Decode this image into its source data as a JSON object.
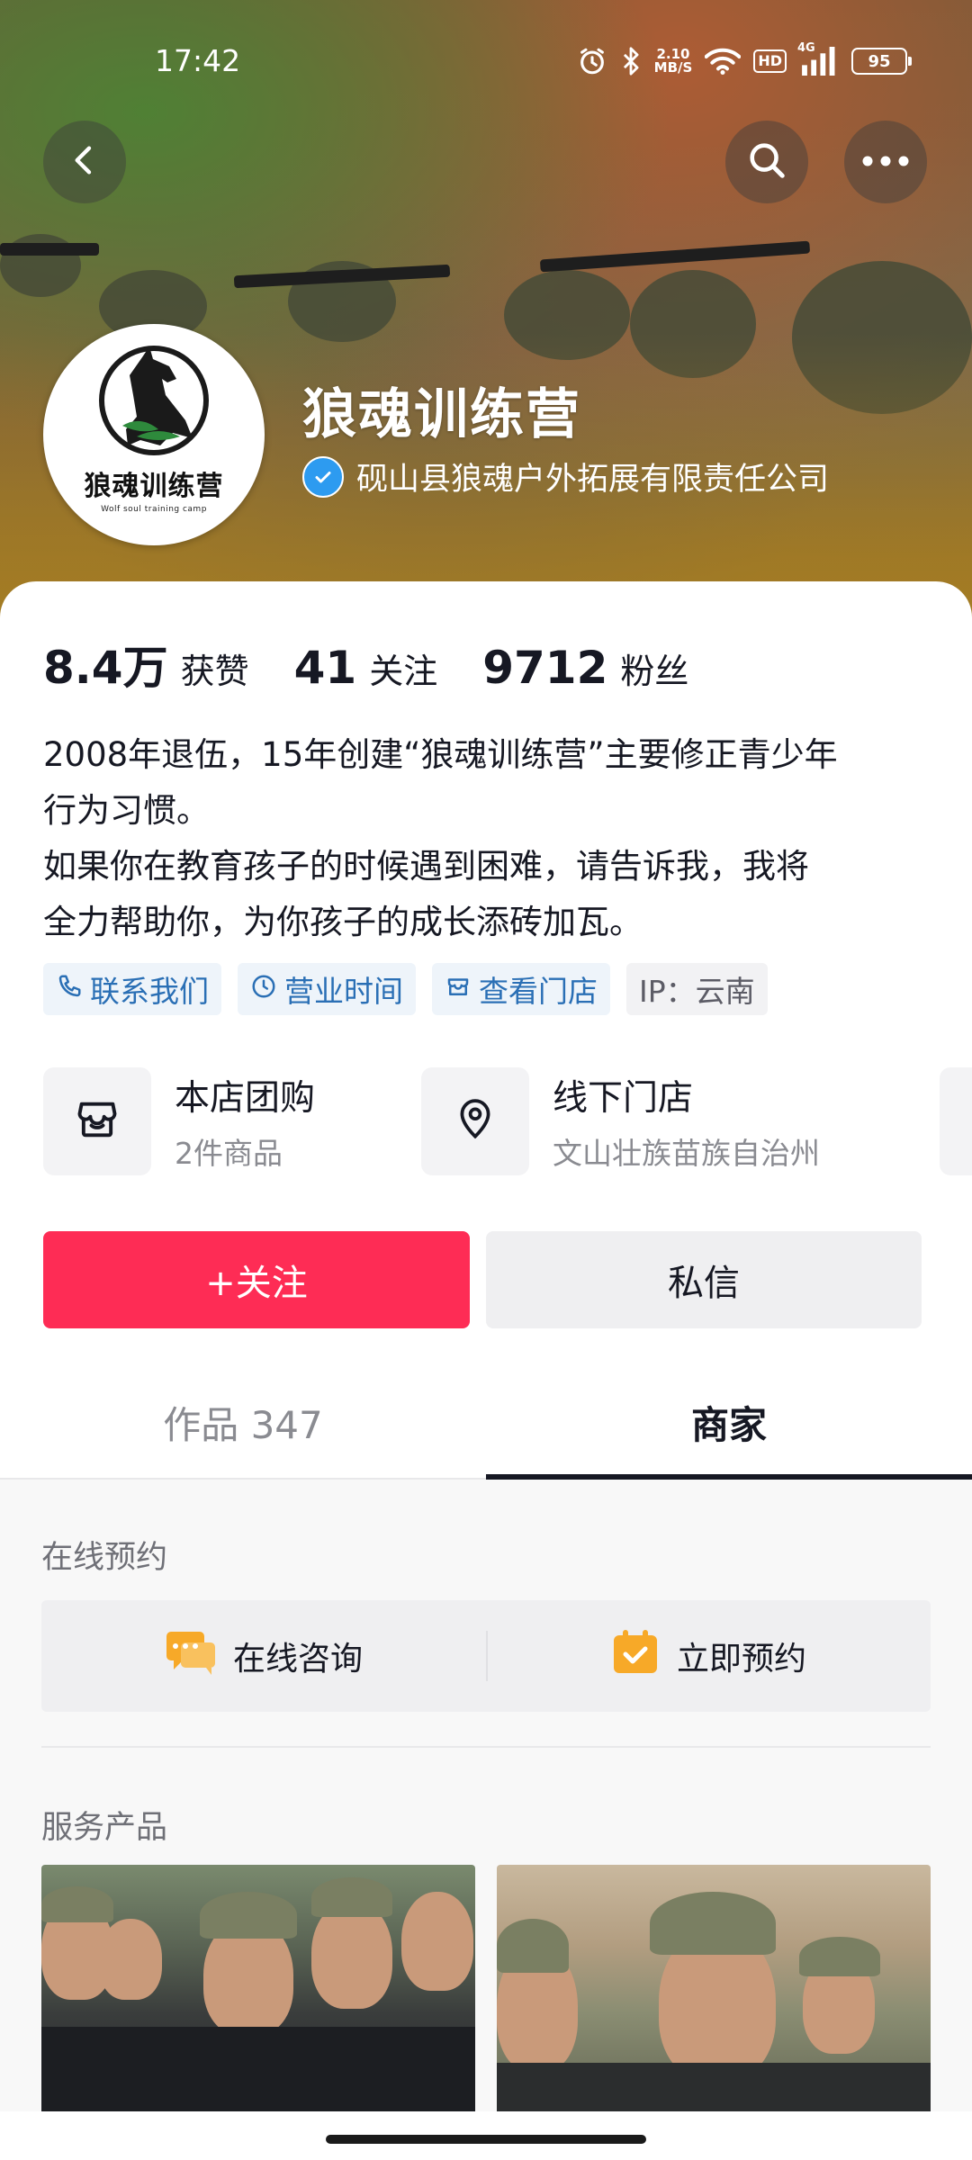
{
  "status_bar": {
    "time": "17:42",
    "net_speed_value": "2.10",
    "net_speed_unit": "MB/S",
    "hd_label": "HD",
    "network_label": "4G",
    "battery": "95"
  },
  "nav": {
    "back_icon": "chevron-left-icon",
    "search_icon": "search-icon",
    "more_icon": "more-horizontal-icon"
  },
  "profile": {
    "name": "狼魂训练营",
    "verified_company": "砚山县狼魂户外拓展有限责任公司",
    "avatar_text": "狼魂训练营",
    "avatar_subtext": "Wolf soul training camp"
  },
  "stats": [
    {
      "value": "8.4万",
      "label": "获赞"
    },
    {
      "value": "41",
      "label": "关注"
    },
    {
      "value": "9712",
      "label": "粉丝"
    }
  ],
  "bio": [
    "2008年退伍，15年创建“狼魂训练营”主要修正青少年",
    "行为习惯。",
    "如果你在教育孩子的时候遇到困难，请告诉我，我将",
    "全力帮助你，为你孩子的成长添砖加瓦。"
  ],
  "chips": [
    {
      "label": "联系我们",
      "icon": "phone-icon"
    },
    {
      "label": "营业时间",
      "icon": "clock-icon"
    },
    {
      "label": "查看门店",
      "icon": "store-icon"
    },
    {
      "label": "IP：云南",
      "icon": ""
    }
  ],
  "stores": [
    {
      "title": "本店团购",
      "subtitle": "2件商品",
      "icon": "shop-bag-icon"
    },
    {
      "title": "线下门店",
      "subtitle": "文山壮族苗族自治州",
      "icon": "location-pin-icon"
    }
  ],
  "actions": {
    "follow": "+关注",
    "message": "私信"
  },
  "tabs": [
    {
      "label": "作品 347",
      "active": false
    },
    {
      "label": "商家",
      "active": true
    }
  ],
  "booking": {
    "section_title": "在线预约",
    "consult": "在线咨询",
    "reserve": "立即预约"
  },
  "services": {
    "section_title": "服务产品"
  },
  "colors": {
    "accent": "#fe2c55",
    "verify": "#2d9bf0",
    "chip_text": "#2a6fb5",
    "booking_icon": "#f7a928"
  }
}
